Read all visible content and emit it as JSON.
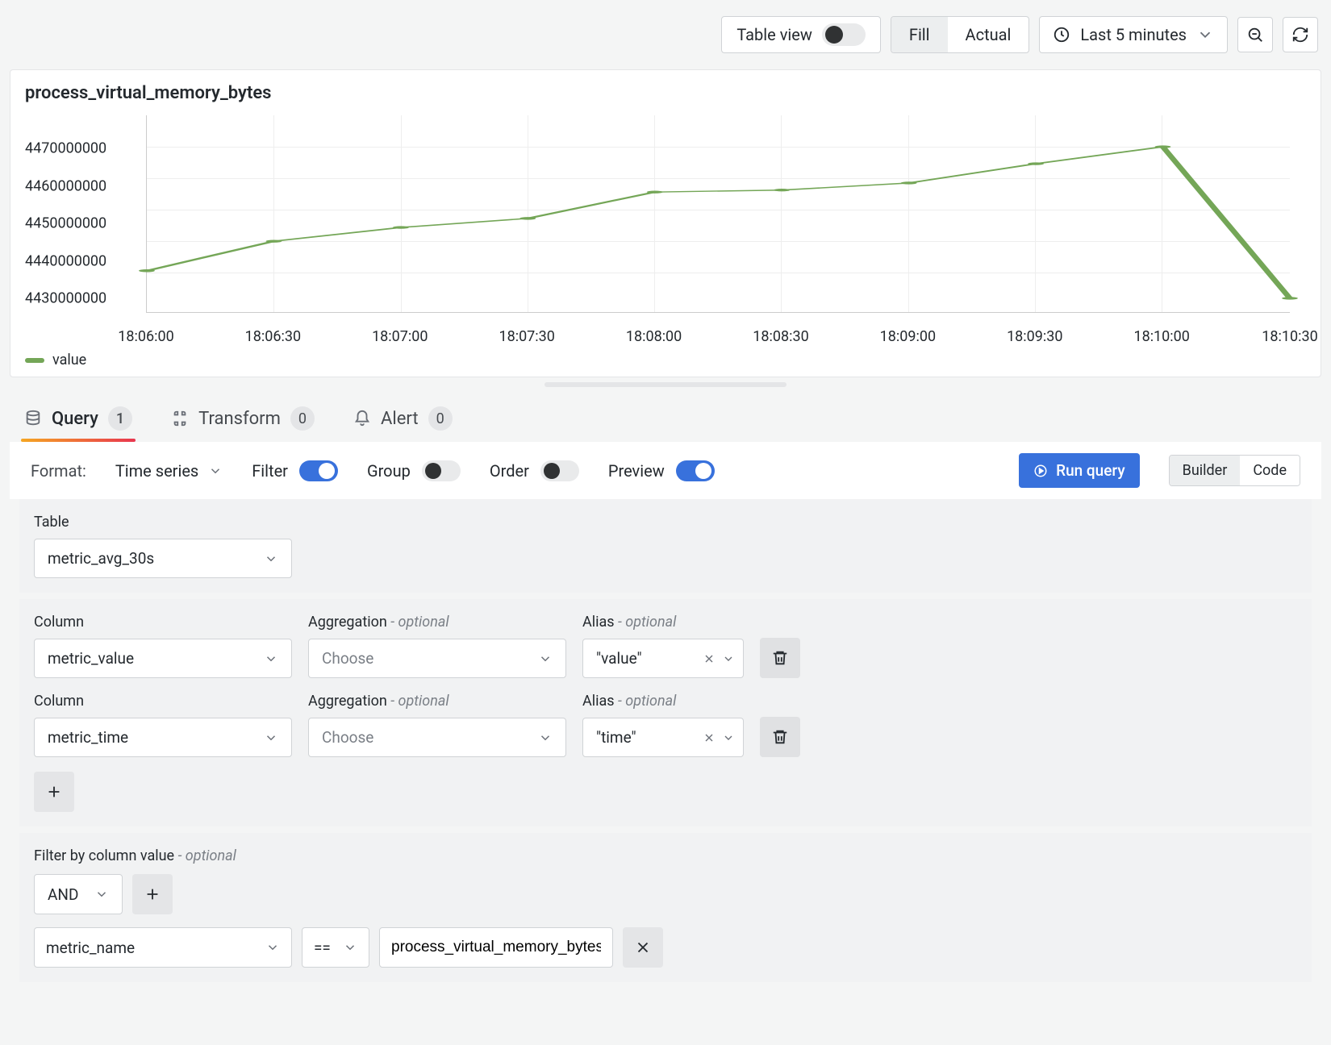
{
  "toolbar": {
    "table_view_label": "Table view",
    "table_view_on": false,
    "fill_label": "Fill",
    "actual_label": "Actual",
    "time_range": "Last 5 minutes"
  },
  "chart_data": {
    "type": "line",
    "title": "process_virtual_memory_bytes",
    "xlabel": "",
    "ylabel": "",
    "ylim": [
      4425000000,
      4475000000
    ],
    "y_ticks": [
      4430000000,
      4440000000,
      4450000000,
      4460000000,
      4470000000
    ],
    "x_labels": [
      "18:06:00",
      "18:06:30",
      "18:07:00",
      "18:07:30",
      "18:08:00",
      "18:08:30",
      "18:09:00",
      "18:09:30",
      "18:10:00",
      "18:10:30"
    ],
    "series": [
      {
        "name": "value",
        "values": [
          4435500000,
          4443000000,
          4446500000,
          4448800000,
          4455500000,
          4456000000,
          4457800000,
          4462700000,
          4467000000,
          4428500000
        ]
      }
    ],
    "legend": [
      "value"
    ],
    "legend_position": "bottom-left",
    "grid": true,
    "color": "#74a657"
  },
  "tabs": {
    "query": {
      "label": "Query",
      "count": 1
    },
    "transform": {
      "label": "Transform",
      "count": 0
    },
    "alert": {
      "label": "Alert",
      "count": 0
    }
  },
  "options": {
    "format_label": "Format:",
    "format_value": "Time series",
    "filter_label": "Filter",
    "filter_on": true,
    "group_label": "Group",
    "group_on": false,
    "order_label": "Order",
    "order_on": false,
    "preview_label": "Preview",
    "preview_on": true,
    "run_query_label": "Run query",
    "builder_label": "Builder",
    "code_label": "Code"
  },
  "builder": {
    "table_label": "Table",
    "table_value": "metric_avg_30s",
    "column_label": "Column",
    "aggregation_label": "Aggregation",
    "optional_text": "- optional",
    "alias_label": "Alias",
    "choose_placeholder": "Choose",
    "rows": [
      {
        "column": "metric_value",
        "aggregation": "",
        "alias": "\"value\""
      },
      {
        "column": "metric_time",
        "aggregation": "",
        "alias": "\"time\""
      }
    ]
  },
  "filter": {
    "section_label": "Filter by column value",
    "optional_text": "- optional",
    "conjunction": "AND",
    "column": "metric_name",
    "operator": "==",
    "value": "process_virtual_memory_bytes"
  }
}
